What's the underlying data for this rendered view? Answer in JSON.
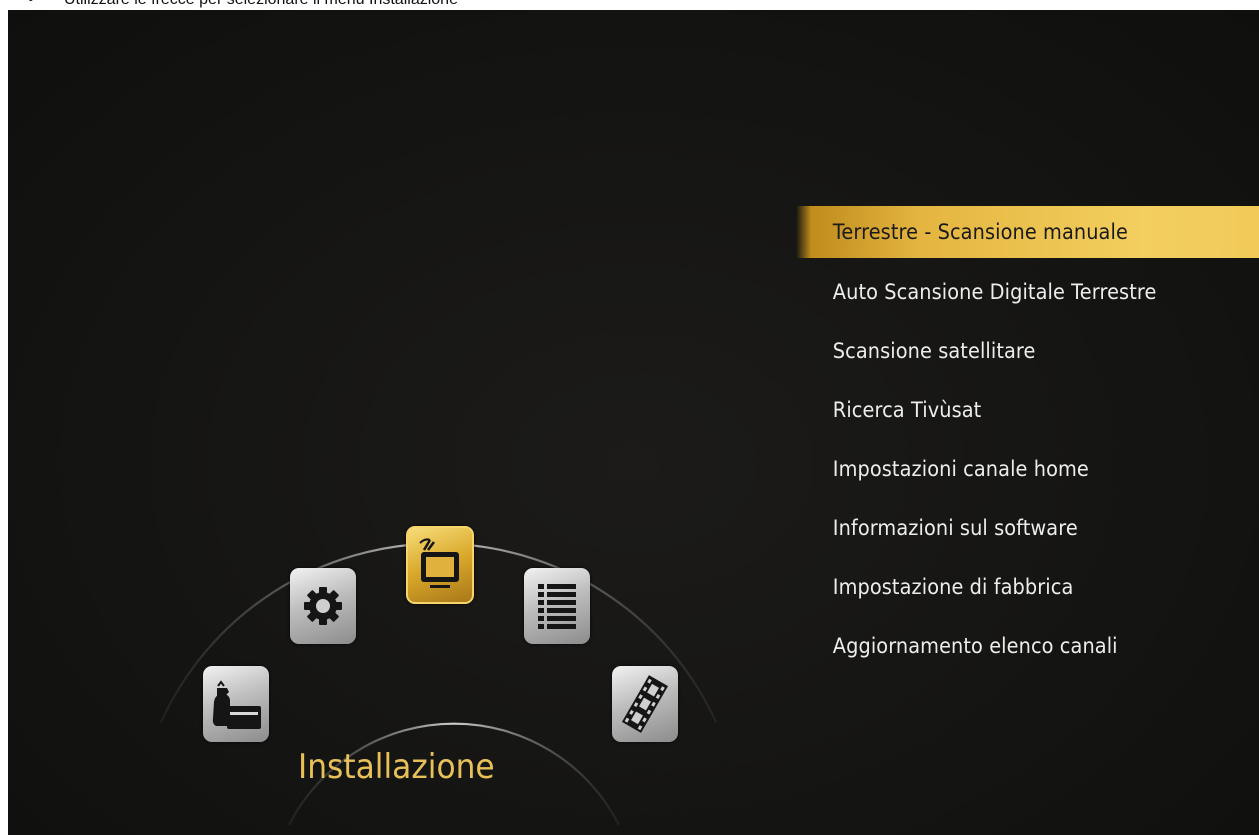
{
  "caption": {
    "bullet": "•",
    "text": "Utilizzare le frecce per selezionare il menù Installazione"
  },
  "menu": {
    "items": [
      {
        "label": "Terrestre - Scansione manuale",
        "selected": true
      },
      {
        "label": "Auto Scansione Digitale Terrestre",
        "selected": false
      },
      {
        "label": "Scansione satellitare",
        "selected": false
      },
      {
        "label": "Ricerca Tivùsat",
        "selected": false
      },
      {
        "label": "Impostazioni canale home",
        "selected": false
      },
      {
        "label": "Informazioni sul software",
        "selected": false
      },
      {
        "label": "Impostazione di fabbrica",
        "selected": false
      },
      {
        "label": "Aggiornamento elenco canali",
        "selected": false
      }
    ]
  },
  "carousel": {
    "title": "Installazione",
    "icons": [
      "media-folder-icon",
      "gear-icon",
      "tv-antenna-icon",
      "list-icon",
      "film-strip-icon"
    ],
    "active_icon": "tv-antenna-icon"
  },
  "colors": {
    "accent": "#e4b540",
    "title": "#e7c057",
    "background": "#141412",
    "menu_text": "#ededed"
  }
}
